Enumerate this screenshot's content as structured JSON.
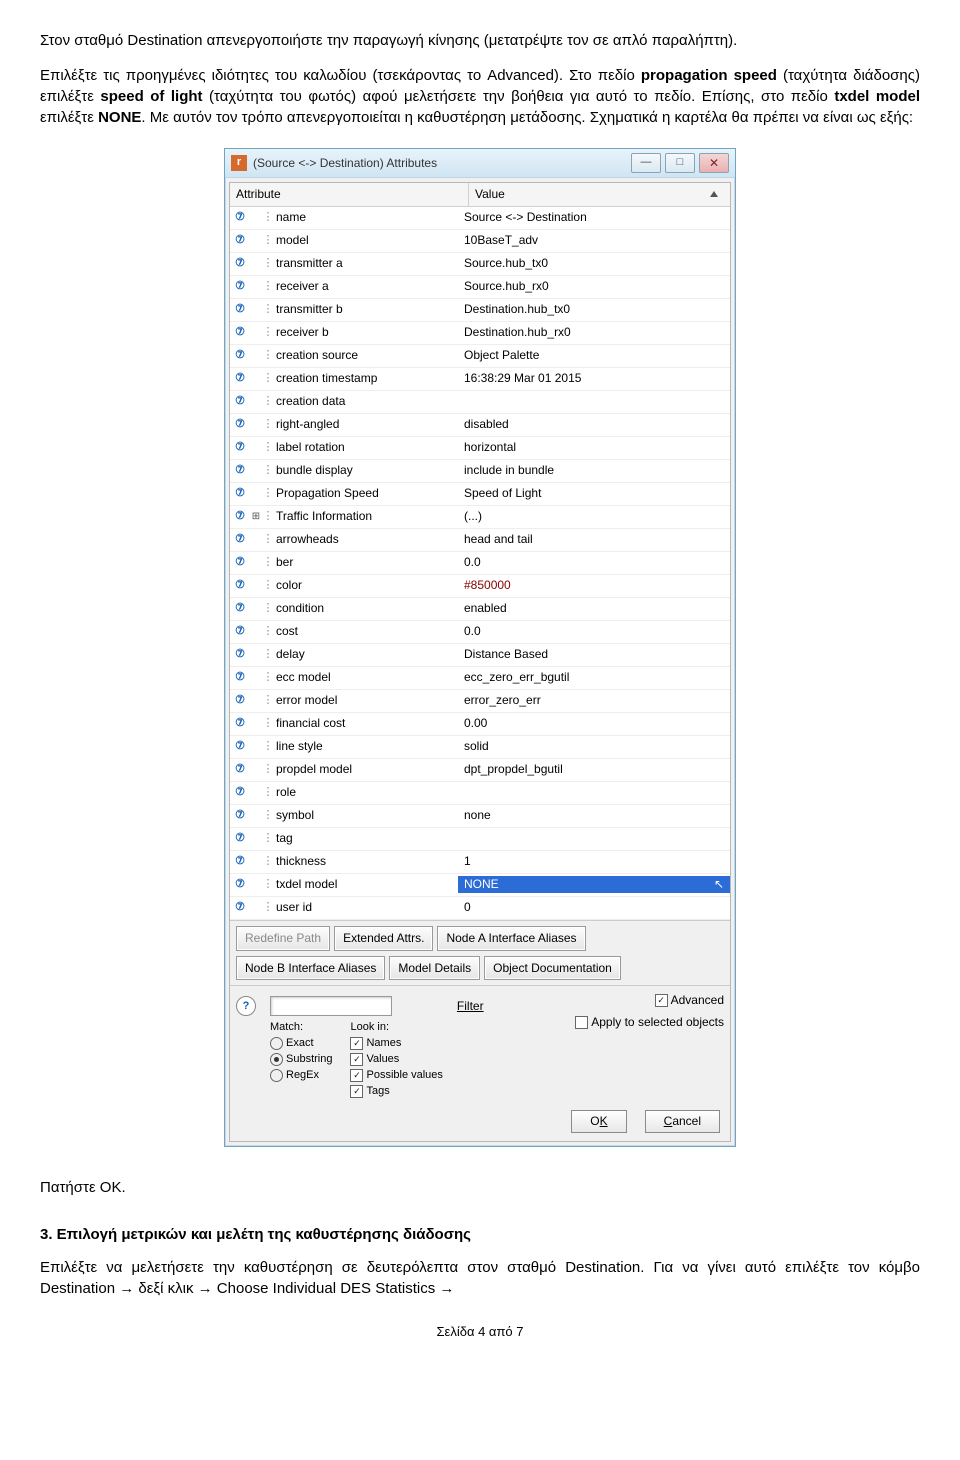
{
  "para1_a": "Στον σταθμό Destination απενεργοποιήστε την παραγωγή κίνησης (μετατρέψτε τον σε απλό παραλήπτη).",
  "para2_a": "Επιλέξτε τις προηγμένες ιδιότητες του καλωδίου (τσεκάροντας το Advanced). Στο πεδίο ",
  "para2_b": "propagation speed",
  "para2_c": " (ταχύτητα διάδοσης) επιλέξτε ",
  "para2_d": "speed of light",
  "para2_e": " (ταχύτητα του φωτός) αφού μελετήσετε την βοήθεια για αυτό το πεδίο. Επίσης, στο πεδίο ",
  "para2_f": "txdel model",
  "para2_g": " επιλέξτε ",
  "para2_h": "NONE",
  "para2_i": ". Με αυτόν τον τρόπο απενεργοποιείται η καθυστέρηση μετάδοσης. Σχηματικά η καρτέλα θα πρέπει να είναι ως εξής:",
  "win": {
    "title": "(Source <-> Destination) Attributes",
    "icon": "r",
    "col1": "Attribute",
    "col2": "Value"
  },
  "rows": [
    {
      "a": "name",
      "v": "Source <-> Destination"
    },
    {
      "a": "model",
      "v": "10BaseT_adv"
    },
    {
      "a": "transmitter a",
      "v": "Source.hub_tx0"
    },
    {
      "a": "receiver a",
      "v": "Source.hub_rx0"
    },
    {
      "a": "transmitter b",
      "v": "Destination.hub_tx0"
    },
    {
      "a": "receiver b",
      "v": "Destination.hub_rx0"
    },
    {
      "a": "creation source",
      "v": "Object Palette"
    },
    {
      "a": "creation timestamp",
      "v": "16:38:29 Mar 01 2015"
    },
    {
      "a": "creation data",
      "v": ""
    },
    {
      "a": "right-angled",
      "v": "disabled"
    },
    {
      "a": "label rotation",
      "v": "horizontal"
    },
    {
      "a": "bundle display",
      "v": "include in bundle"
    },
    {
      "a": "Propagation Speed",
      "v": "Speed of Light"
    },
    {
      "a": "Traffic Information",
      "v": "(...)",
      "plus": true
    },
    {
      "a": "arrowheads",
      "v": "head and tail"
    },
    {
      "a": "ber",
      "v": "0.0"
    },
    {
      "a": "color",
      "v": "#850000",
      "red": true
    },
    {
      "a": "condition",
      "v": "enabled"
    },
    {
      "a": "cost",
      "v": "0.0"
    },
    {
      "a": "delay",
      "v": "Distance Based"
    },
    {
      "a": "ecc model",
      "v": "ecc_zero_err_bgutil"
    },
    {
      "a": "error model",
      "v": "error_zero_err"
    },
    {
      "a": "financial cost",
      "v": "0.00"
    },
    {
      "a": "line style",
      "v": "solid"
    },
    {
      "a": "propdel model",
      "v": "dpt_propdel_bgutil"
    },
    {
      "a": "role",
      "v": ""
    },
    {
      "a": "symbol",
      "v": "none"
    },
    {
      "a": "tag",
      "v": ""
    },
    {
      "a": "thickness",
      "v": "1"
    },
    {
      "a": "txdel model",
      "v": "NONE",
      "sel": true
    },
    {
      "a": "user id",
      "v": "0"
    }
  ],
  "btns": {
    "redef": "Redefine Path",
    "ext": "Extended Attrs.",
    "na": "Node A Interface Aliases",
    "nb": "Node B Interface Aliases",
    "md": "Model Details",
    "od": "Object Documentation"
  },
  "filter": {
    "label": "Filter",
    "match": "Match:",
    "exact": "Exact",
    "sub": "Substring",
    "regex": "RegEx",
    "look": "Look in:",
    "names": "Names",
    "values": "Values",
    "poss": "Possible values",
    "tags": "Tags"
  },
  "right": {
    "adv": "Advanced",
    "apply": "Apply to selected objects",
    "ok_pre": "O",
    "ok_u": "K",
    "cancel_u": "C",
    "cancel_rest": "ancel"
  },
  "press": "Πατήστε ΟΚ.",
  "h3": "3. Επιλογή μετρικών και μελέτη της καθυστέρησης διάδοσης",
  "para3": "Επιλέξτε να μελετήσετε την καθυστέρηση σε δευτερόλεπτα στον σταθμό Destination. Για να γίνει αυτό επιλέξτε τον κόμβο Destination → δεξί κλικ → Choose Individual DES Statistics →",
  "footer": "Σελίδα 4 από 7"
}
